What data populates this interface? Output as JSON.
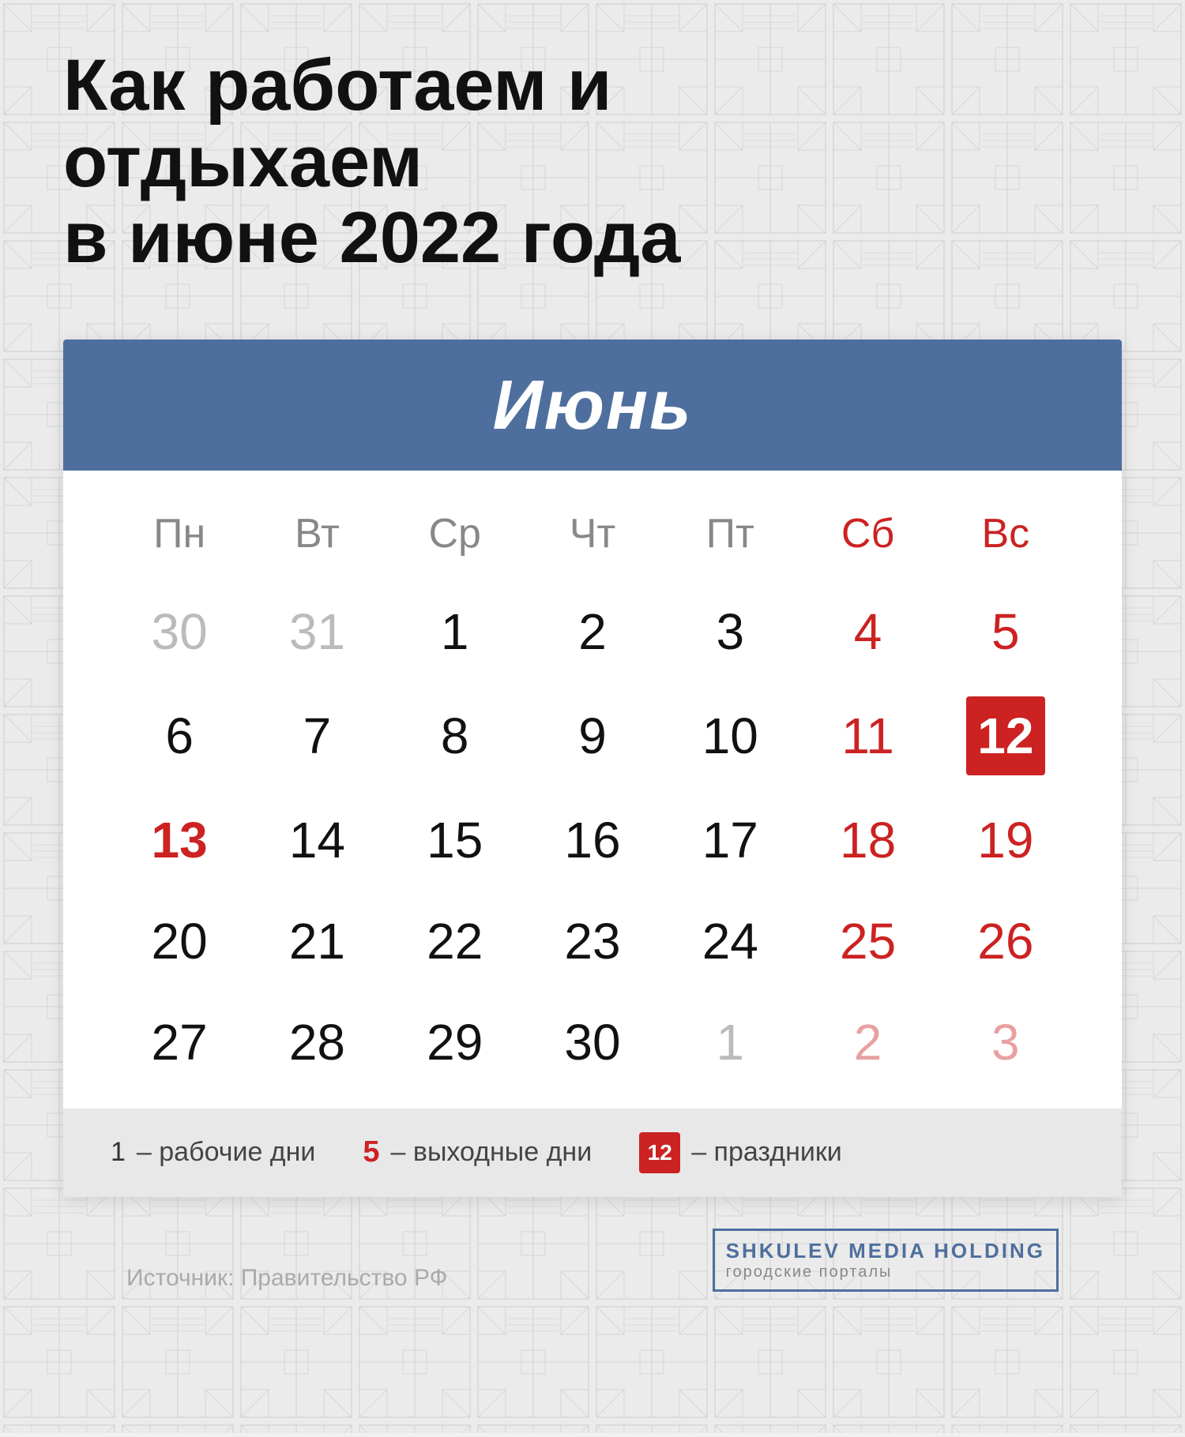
{
  "page": {
    "title_line1": "Как работаем и отдыхаем",
    "title_line2": "в июне 2022 года",
    "background_color": "#eeeeee"
  },
  "calendar": {
    "month_title": "Июнь",
    "header_color": "#4e6f9e",
    "day_headers": [
      {
        "label": "Пн",
        "type": "weekday"
      },
      {
        "label": "Вт",
        "type": "weekday"
      },
      {
        "label": "Ср",
        "type": "weekday"
      },
      {
        "label": "Чт",
        "type": "weekday"
      },
      {
        "label": "Пт",
        "type": "weekday"
      },
      {
        "label": "Сб",
        "type": "weekend"
      },
      {
        "label": "Вс",
        "type": "weekend"
      }
    ],
    "weeks": [
      [
        {
          "num": "30",
          "type": "other-month"
        },
        {
          "num": "31",
          "type": "other-month"
        },
        {
          "num": "1",
          "type": "normal"
        },
        {
          "num": "2",
          "type": "normal"
        },
        {
          "num": "3",
          "type": "normal"
        },
        {
          "num": "4",
          "type": "weekend-red"
        },
        {
          "num": "5",
          "type": "weekend-red"
        }
      ],
      [
        {
          "num": "6",
          "type": "normal"
        },
        {
          "num": "7",
          "type": "normal"
        },
        {
          "num": "8",
          "type": "normal"
        },
        {
          "num": "9",
          "type": "normal"
        },
        {
          "num": "10",
          "type": "normal"
        },
        {
          "num": "11",
          "type": "weekend-red"
        },
        {
          "num": "12",
          "type": "holiday-highlight"
        }
      ],
      [
        {
          "num": "13",
          "type": "holiday-special"
        },
        {
          "num": "14",
          "type": "normal"
        },
        {
          "num": "15",
          "type": "normal"
        },
        {
          "num": "16",
          "type": "normal"
        },
        {
          "num": "17",
          "type": "normal"
        },
        {
          "num": "18",
          "type": "weekend-red"
        },
        {
          "num": "19",
          "type": "weekend-red"
        }
      ],
      [
        {
          "num": "20",
          "type": "normal"
        },
        {
          "num": "21",
          "type": "normal"
        },
        {
          "num": "22",
          "type": "normal"
        },
        {
          "num": "23",
          "type": "normal"
        },
        {
          "num": "24",
          "type": "normal"
        },
        {
          "num": "25",
          "type": "weekend-red"
        },
        {
          "num": "26",
          "type": "weekend-red"
        }
      ],
      [
        {
          "num": "27",
          "type": "normal"
        },
        {
          "num": "28",
          "type": "normal"
        },
        {
          "num": "29",
          "type": "normal"
        },
        {
          "num": "30",
          "type": "normal"
        },
        {
          "num": "1",
          "type": "other-month"
        },
        {
          "num": "2",
          "type": "other-month-red"
        },
        {
          "num": "3",
          "type": "other-month-red"
        }
      ]
    ]
  },
  "legend": {
    "item1_num": "1",
    "item1_text": "– рабочие дни",
    "item2_num": "5",
    "item2_text": "– выходные дни",
    "item3_num": "12",
    "item3_text": "– праздники"
  },
  "footer": {
    "source": "Источник: Правительство РФ",
    "brand_line1_part1": "SHKULEV",
    "brand_line1_part2": " MEDIA HOLDING",
    "brand_line2": "городские порталы"
  }
}
